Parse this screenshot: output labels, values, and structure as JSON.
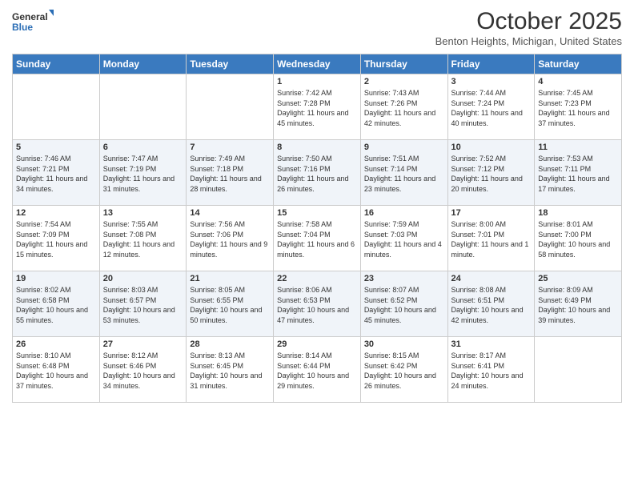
{
  "logo": {
    "general": "General",
    "blue": "Blue"
  },
  "header": {
    "month": "October 2025",
    "location": "Benton Heights, Michigan, United States"
  },
  "weekdays": [
    "Sunday",
    "Monday",
    "Tuesday",
    "Wednesday",
    "Thursday",
    "Friday",
    "Saturday"
  ],
  "weeks": [
    [
      {
        "day": "",
        "info": ""
      },
      {
        "day": "",
        "info": ""
      },
      {
        "day": "",
        "info": ""
      },
      {
        "day": "1",
        "info": "Sunrise: 7:42 AM\nSunset: 7:28 PM\nDaylight: 11 hours and 45 minutes."
      },
      {
        "day": "2",
        "info": "Sunrise: 7:43 AM\nSunset: 7:26 PM\nDaylight: 11 hours and 42 minutes."
      },
      {
        "day": "3",
        "info": "Sunrise: 7:44 AM\nSunset: 7:24 PM\nDaylight: 11 hours and 40 minutes."
      },
      {
        "day": "4",
        "info": "Sunrise: 7:45 AM\nSunset: 7:23 PM\nDaylight: 11 hours and 37 minutes."
      }
    ],
    [
      {
        "day": "5",
        "info": "Sunrise: 7:46 AM\nSunset: 7:21 PM\nDaylight: 11 hours and 34 minutes."
      },
      {
        "day": "6",
        "info": "Sunrise: 7:47 AM\nSunset: 7:19 PM\nDaylight: 11 hours and 31 minutes."
      },
      {
        "day": "7",
        "info": "Sunrise: 7:49 AM\nSunset: 7:18 PM\nDaylight: 11 hours and 28 minutes."
      },
      {
        "day": "8",
        "info": "Sunrise: 7:50 AM\nSunset: 7:16 PM\nDaylight: 11 hours and 26 minutes."
      },
      {
        "day": "9",
        "info": "Sunrise: 7:51 AM\nSunset: 7:14 PM\nDaylight: 11 hours and 23 minutes."
      },
      {
        "day": "10",
        "info": "Sunrise: 7:52 AM\nSunset: 7:12 PM\nDaylight: 11 hours and 20 minutes."
      },
      {
        "day": "11",
        "info": "Sunrise: 7:53 AM\nSunset: 7:11 PM\nDaylight: 11 hours and 17 minutes."
      }
    ],
    [
      {
        "day": "12",
        "info": "Sunrise: 7:54 AM\nSunset: 7:09 PM\nDaylight: 11 hours and 15 minutes."
      },
      {
        "day": "13",
        "info": "Sunrise: 7:55 AM\nSunset: 7:08 PM\nDaylight: 11 hours and 12 minutes."
      },
      {
        "day": "14",
        "info": "Sunrise: 7:56 AM\nSunset: 7:06 PM\nDaylight: 11 hours and 9 minutes."
      },
      {
        "day": "15",
        "info": "Sunrise: 7:58 AM\nSunset: 7:04 PM\nDaylight: 11 hours and 6 minutes."
      },
      {
        "day": "16",
        "info": "Sunrise: 7:59 AM\nSunset: 7:03 PM\nDaylight: 11 hours and 4 minutes."
      },
      {
        "day": "17",
        "info": "Sunrise: 8:00 AM\nSunset: 7:01 PM\nDaylight: 11 hours and 1 minute."
      },
      {
        "day": "18",
        "info": "Sunrise: 8:01 AM\nSunset: 7:00 PM\nDaylight: 10 hours and 58 minutes."
      }
    ],
    [
      {
        "day": "19",
        "info": "Sunrise: 8:02 AM\nSunset: 6:58 PM\nDaylight: 10 hours and 55 minutes."
      },
      {
        "day": "20",
        "info": "Sunrise: 8:03 AM\nSunset: 6:57 PM\nDaylight: 10 hours and 53 minutes."
      },
      {
        "day": "21",
        "info": "Sunrise: 8:05 AM\nSunset: 6:55 PM\nDaylight: 10 hours and 50 minutes."
      },
      {
        "day": "22",
        "info": "Sunrise: 8:06 AM\nSunset: 6:53 PM\nDaylight: 10 hours and 47 minutes."
      },
      {
        "day": "23",
        "info": "Sunrise: 8:07 AM\nSunset: 6:52 PM\nDaylight: 10 hours and 45 minutes."
      },
      {
        "day": "24",
        "info": "Sunrise: 8:08 AM\nSunset: 6:51 PM\nDaylight: 10 hours and 42 minutes."
      },
      {
        "day": "25",
        "info": "Sunrise: 8:09 AM\nSunset: 6:49 PM\nDaylight: 10 hours and 39 minutes."
      }
    ],
    [
      {
        "day": "26",
        "info": "Sunrise: 8:10 AM\nSunset: 6:48 PM\nDaylight: 10 hours and 37 minutes."
      },
      {
        "day": "27",
        "info": "Sunrise: 8:12 AM\nSunset: 6:46 PM\nDaylight: 10 hours and 34 minutes."
      },
      {
        "day": "28",
        "info": "Sunrise: 8:13 AM\nSunset: 6:45 PM\nDaylight: 10 hours and 31 minutes."
      },
      {
        "day": "29",
        "info": "Sunrise: 8:14 AM\nSunset: 6:44 PM\nDaylight: 10 hours and 29 minutes."
      },
      {
        "day": "30",
        "info": "Sunrise: 8:15 AM\nSunset: 6:42 PM\nDaylight: 10 hours and 26 minutes."
      },
      {
        "day": "31",
        "info": "Sunrise: 8:17 AM\nSunset: 6:41 PM\nDaylight: 10 hours and 24 minutes."
      },
      {
        "day": "",
        "info": ""
      }
    ]
  ]
}
